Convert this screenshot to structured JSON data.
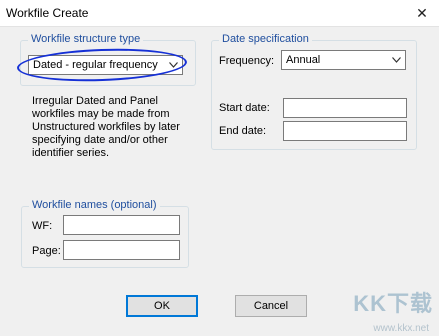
{
  "window": {
    "title": "Workfile Create"
  },
  "structure": {
    "group_label": "Workfile structure type",
    "selected": "Dated - regular frequency",
    "description": "Irregular Dated and Panel workfiles may be made from Unstructured workfiles by later specifying date and/or other identifier series."
  },
  "date_spec": {
    "group_label": "Date specification",
    "frequency_label": "Frequency:",
    "frequency_value": "Annual",
    "start_label": "Start date:",
    "start_value": "",
    "end_label": "End date:",
    "end_value": ""
  },
  "names": {
    "group_label": "Workfile names (optional)",
    "wf_label": "WF:",
    "wf_value": "",
    "page_label": "Page:",
    "page_value": ""
  },
  "buttons": {
    "ok": "OK",
    "cancel": "Cancel"
  },
  "icons": {
    "close": "close-icon",
    "dropdown": "chevron-down-icon"
  },
  "watermark": {
    "brand": "KK下载",
    "url": "www.kkx.net"
  },
  "colors": {
    "group_label": "#1f4e9e",
    "annotation": "#1530d6"
  }
}
